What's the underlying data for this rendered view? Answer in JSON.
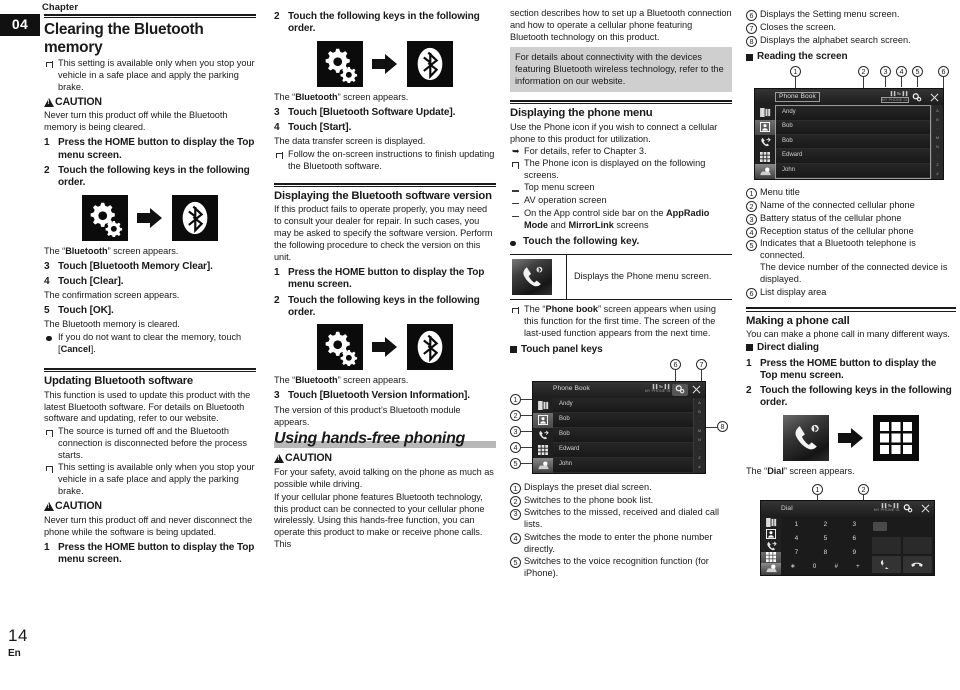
{
  "page": {
    "chapter_label": "Chapter",
    "chapter_number": "04",
    "page_number": "14",
    "language_code": "En"
  },
  "col1": {
    "title": "Clearing the Bluetooth memory",
    "note1": "This setting is available only when you stop your vehicle in a safe place and apply the parking brake.",
    "caution_label": "CAUTION",
    "caution_text": "Never turn this product off while the Bluetooth memory is being cleared.",
    "step1_n": "1",
    "step1": "Press the HOME button to display the Top menu screen.",
    "step2_n": "2",
    "step2": "Touch the following keys in the following order.",
    "after_keys_pre": "The “",
    "after_keys_bold": "Bluetooth",
    "after_keys_post": "” screen appears.",
    "step3_n": "3",
    "step3": "Touch [Bluetooth Memory Clear].",
    "step4_n": "4",
    "step4": "Touch [Clear].",
    "step4_desc": "The confirmation screen appears.",
    "step5_n": "5",
    "step5": "Touch [OK].",
    "step5_desc": "The Bluetooth memory is cleared.",
    "bullet_pre": "If you do not want to clear the memory, touch [",
    "bullet_bold": "Cancel",
    "bullet_post": "].",
    "section2_title": "Updating Bluetooth software",
    "section2_intro": "This function is used to update this product with the latest Bluetooth software. For details on Bluetooth software and updating, refer to our website.",
    "section2_note1": "The source is turned off and the Bluetooth connection is disconnected before the process starts.",
    "section2_note2": "This setting is available only when you stop your vehicle in a safe place and apply the parking brake.",
    "section2_caution": "Never turn this product off and never disconnect the phone while the software is being updated.",
    "section2_step1_n": "1",
    "section2_step1": "Press the HOME button to display the Top menu screen."
  },
  "col2": {
    "step2_n": "2",
    "step2": "Touch the following keys in the following order.",
    "after_keys_pre": "The “",
    "after_keys_bold": "Bluetooth",
    "after_keys_post": "” screen appears.",
    "step3_n": "3",
    "step3": "Touch [Bluetooth Software Update].",
    "step4_n": "4",
    "step4": "Touch [Start].",
    "step4_desc": "The data transfer screen is displayed.",
    "note1": "Follow the on-screen instructions to finish updating the Bluetooth software.",
    "section_title": "Displaying the Bluetooth software version",
    "section_intro": "If this product fails to operate properly, you may need to consult your dealer for repair. In such cases, you may be asked to specify the software version. Perform the following procedure to check the version on this unit.",
    "s_step1_n": "1",
    "s_step1": "Press the HOME button to display the Top menu screen.",
    "s_step2_n": "2",
    "s_step2": "Touch the following keys in the following order.",
    "s_after_pre": "The “",
    "s_after_bold": "Bluetooth",
    "s_after_post": "” screen appears.",
    "s_step3_n": "3",
    "s_step3": "Touch [Bluetooth Version Information].",
    "s_step3_desc": "The version of this product’s Bluetooth module appears.",
    "big_title": "Using hands-free phoning",
    "caution_label": "CAUTION",
    "caution_text": "For your safety, avoid talking on the phone as much as possible while driving.",
    "intro": "If your cellular phone features Bluetooth technology, this product can be connected to your cellular phone wirelessly. Using this hands-free function, you can operate this product to make or receive phone calls. This"
  },
  "col3": {
    "intro_cont": "section describes how to set up a Bluetooth connection and how to operate a cellular phone featuring Bluetooth technology on this product.",
    "graybox": "For details about connectivity with the devices featuring Bluetooth wireless technology, refer to the information on our website.",
    "section_title": "Displaying the phone menu",
    "section_intro": "Use the Phone icon if you wish to connect a cellular phone to this product for utilization.",
    "ref_note": "For details, refer to Chapter 3.",
    "note1": "The Phone icon is displayed on the following screens.",
    "dash1": "Top menu screen",
    "dash2": "AV operation screen",
    "dash3_pre": "On the App control side bar on the ",
    "dash3_b1": "AppRadio Mode",
    "dash3_mid": " and ",
    "dash3_b2": "MirrorLink",
    "dash3_post": " screens",
    "touch_key": "Touch the following key.",
    "icon_desc": "Displays the Phone menu screen.",
    "note2_pre": "The “",
    "note2_bold": "Phone book",
    "note2_post": "” screen appears when using this function for the first time. The screen of the last-used function appears from the next time.",
    "panel_heading": "Touch panel keys",
    "shot": {
      "title": "Phone Book",
      "status_line1": "▐▐ ‰ ▌▌",
      "status_line2": "MY PHONE 01",
      "rows": [
        "Andy",
        "Bob",
        "Bob",
        "Edward",
        "John"
      ],
      "alpha": [
        "A",
        "B",
        "·",
        "M",
        "N",
        "·",
        "Z",
        "#"
      ]
    },
    "callouts": [
      "1",
      "2",
      "3",
      "4",
      "5",
      "6",
      "7",
      "8"
    ],
    "defs": [
      "Displays the preset dial screen.",
      "Switches to the phone book list.",
      "Switches to the missed, received and dialed call lists.",
      "Switches the mode to enter the phone number directly.",
      "Switches to the voice recognition function (for iPhone)."
    ],
    "def_nums": [
      "1",
      "2",
      "3",
      "4",
      "5"
    ]
  },
  "col4": {
    "defs_top": [
      "Displays the Setting menu screen.",
      "Closes the screen.",
      "Displays the alphabet search screen."
    ],
    "def_nums_top": [
      "6",
      "7",
      "8"
    ],
    "reading_heading": "Reading the screen",
    "shot": {
      "title": "Phone Book",
      "status_line1": "▐▐ ‰ ▌▌",
      "status_line2": "MY PHONE 01",
      "rows": [
        "Andy",
        "Bob",
        "Bob",
        "Edward",
        "John"
      ],
      "alpha": [
        "A",
        "B",
        "·",
        "M",
        "N",
        "·",
        "Z",
        "#"
      ]
    },
    "callouts": [
      "1",
      "2",
      "3",
      "4",
      "5",
      "6"
    ],
    "def_nums": [
      "1",
      "2",
      "3",
      "4",
      "5",
      "6"
    ],
    "defs": [
      "Menu title",
      "Name of the connected cellular phone",
      "Battery status of the cellular phone",
      "Reception status of the cellular phone",
      "Indicates that a Bluetooth telephone is connected.",
      "List display area"
    ],
    "def5_cont": "The device number of the connected device is displayed.",
    "section_title": "Making a phone call",
    "section_intro": "You can make a phone call in many different ways.",
    "sub_heading": "Direct dialing",
    "step1_n": "1",
    "step1": "Press the HOME button to display the Top menu screen.",
    "step2_n": "2",
    "step2": "Touch the following keys in the following order.",
    "after_pre": "The “",
    "after_bold": "Dial",
    "after_post": "” screen appears.",
    "dial_callouts": [
      "1",
      "2"
    ],
    "dial_shot": {
      "title": "Dial",
      "status_line1": "▐▐ ‰ ▌▌",
      "status_line2": "MY PHONE 01",
      "keys": [
        "1",
        "2",
        "3",
        "4",
        "5",
        "6",
        "7",
        "8",
        "9",
        "∗",
        "0",
        "#",
        "+"
      ]
    }
  }
}
